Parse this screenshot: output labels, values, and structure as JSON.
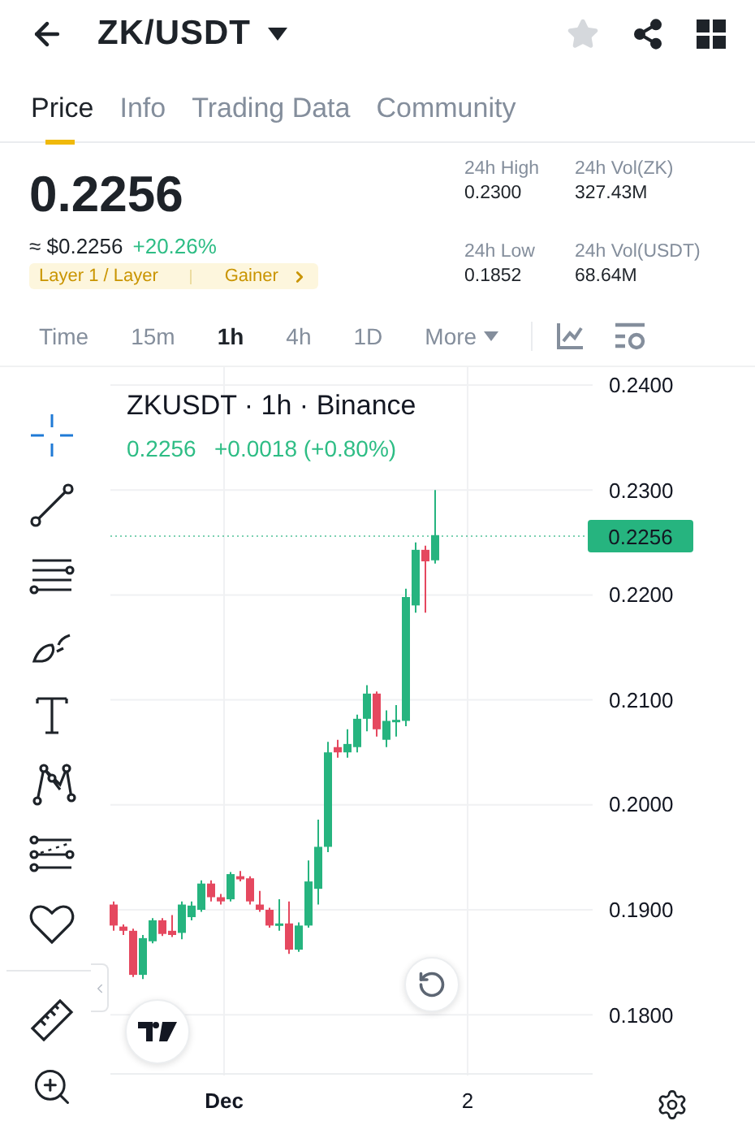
{
  "header": {
    "title": "ZK/USDT"
  },
  "tabs": [
    {
      "label": "Price",
      "selected": true
    },
    {
      "label": "Info",
      "selected": false
    },
    {
      "label": "Trading Data",
      "selected": false
    },
    {
      "label": "Community",
      "selected": false
    }
  ],
  "price": {
    "last": "0.2256",
    "usd": "≈ $0.2256",
    "change": "+20.26%",
    "tags": [
      "Layer 1 / Layer",
      "Gainer"
    ]
  },
  "stats": [
    {
      "label": "24h High",
      "value": "0.2300"
    },
    {
      "label": "24h Vol(ZK)",
      "value": "327.43M"
    },
    {
      "label": "24h Low",
      "value": "0.1852"
    },
    {
      "label": "24h Vol(USDT)",
      "value": "68.64M"
    }
  ],
  "intervals": [
    {
      "label": "Time",
      "selected": false
    },
    {
      "label": "15m",
      "selected": false
    },
    {
      "label": "1h",
      "selected": true
    },
    {
      "label": "4h",
      "selected": false
    },
    {
      "label": "1D",
      "selected": false
    },
    {
      "label": "More",
      "selected": false
    }
  ],
  "chart": {
    "title": "ZKUSDT · 1h · Binance",
    "quote": "0.2256",
    "delta": "+0.0018 (+0.80%)",
    "current_price": "0.2256",
    "price_labels": [
      "0.2400",
      "0.2300",
      "0.2200",
      "0.2100",
      "0.2000",
      "0.1900",
      "0.1800"
    ],
    "time_labels": [
      "Dec",
      "2"
    ]
  }
}
